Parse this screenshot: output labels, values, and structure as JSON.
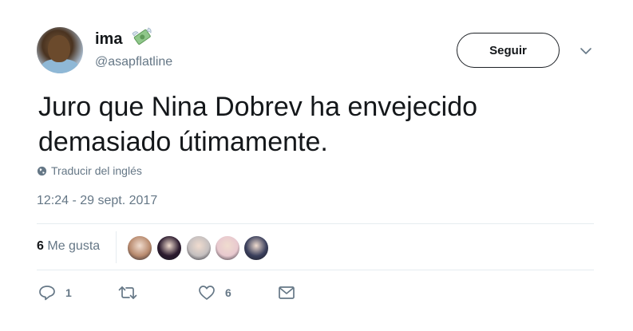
{
  "user": {
    "name": "ima",
    "handle": "@asapflatline"
  },
  "header": {
    "follow_label": "Seguir"
  },
  "tweet": {
    "text_line1": "Juro que Nina Dobrev ha envejecido",
    "text_line2": "demasiado útimamente.",
    "translate_label": "Traducir del inglés",
    "timestamp": "12:24 - 29 sept. 2017"
  },
  "stats": {
    "likes_count": "6",
    "likes_label": "Me gusta",
    "likers": [
      {
        "color": "#b88a6e"
      },
      {
        "color": "#2b1a2e"
      },
      {
        "color": "#c4bfbf"
      },
      {
        "color": "#e8c9cf"
      },
      {
        "color": "#3a3f5c"
      }
    ]
  },
  "actions": {
    "reply_count": "1",
    "retweet_count": "",
    "like_count": "6"
  },
  "icons": {
    "name_emoji": "money-with-wings-icon",
    "dropdown": "chevron-down-icon",
    "translate": "globe-icon",
    "reply": "reply-icon",
    "retweet": "retweet-icon",
    "like": "heart-icon",
    "message": "envelope-icon"
  }
}
